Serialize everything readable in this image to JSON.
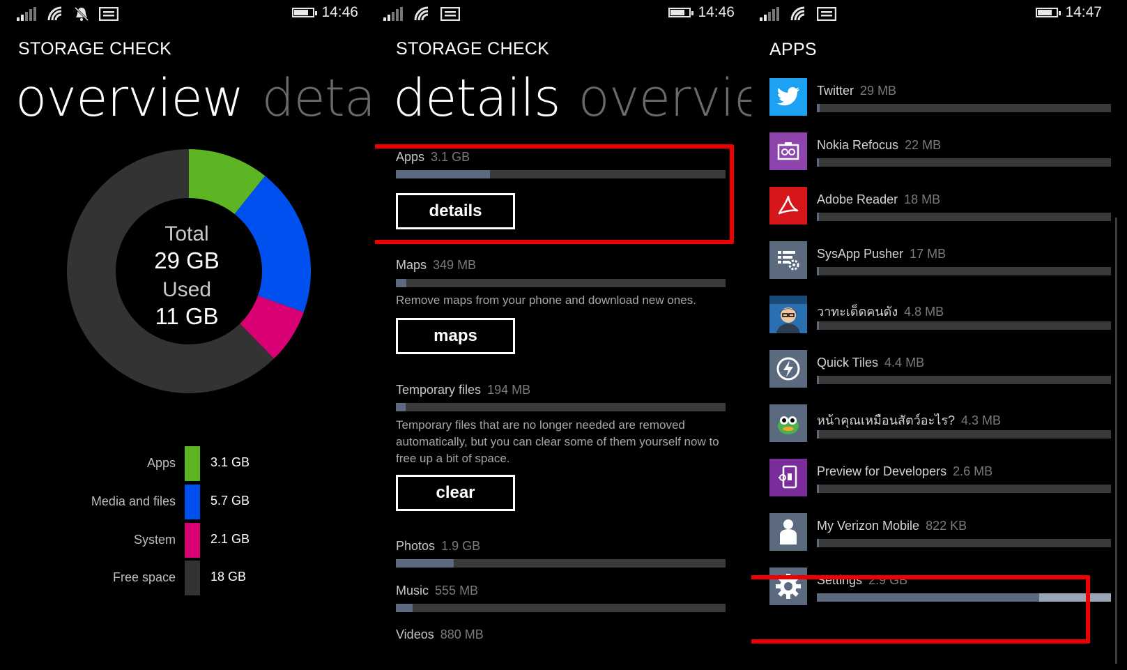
{
  "status": [
    {
      "time": "14:46"
    },
    {
      "time": "14:46"
    },
    {
      "time": "14:47"
    }
  ],
  "overview": {
    "app_title": "STORAGE CHECK",
    "pivot_active": "overview",
    "pivot_next": "detail",
    "center": {
      "total_label": "Total",
      "total_value": "29 GB",
      "used_label": "Used",
      "used_value": "11 GB"
    },
    "legend": [
      {
        "label": "Apps",
        "value": "3.1 GB",
        "color": "#5eb524"
      },
      {
        "label": "Media and files",
        "value": "5.7 GB",
        "color": "#0050ef"
      },
      {
        "label": "System",
        "value": "2.1 GB",
        "color": "#d80073"
      },
      {
        "label": "Free space",
        "value": "18 GB",
        "color": "#333333"
      }
    ],
    "chart_data": {
      "type": "pie",
      "categories": [
        "Apps",
        "Media and files",
        "System",
        "Free space"
      ],
      "values": [
        3.1,
        5.7,
        2.1,
        18
      ],
      "colors": [
        "#5eb524",
        "#0050ef",
        "#d80073",
        "#333333"
      ]
    }
  },
  "details": {
    "app_title": "STORAGE CHECK",
    "pivot_active": "details",
    "pivot_next": "overview",
    "categories": [
      {
        "name": "Apps",
        "size": "3.1 GB",
        "fraction": 0.285,
        "button": "details"
      },
      {
        "name": "Maps",
        "size": "349 MB",
        "fraction": 0.032,
        "desc": "Remove maps from your phone and download new ones.",
        "button": "maps"
      },
      {
        "name": "Temporary files",
        "size": "194 MB",
        "fraction": 0.018,
        "desc": "Temporary files that are no longer needed are removed automatically, but you can clear some of them yourself now to free up a bit of space.",
        "button": "clear"
      },
      {
        "name": "Photos",
        "size": "1.9 GB",
        "fraction": 0.175
      },
      {
        "name": "Music",
        "size": "555 MB",
        "fraction": 0.05
      },
      {
        "name": "Videos",
        "size": "880 MB"
      }
    ]
  },
  "apps": {
    "app_title": "APPS",
    "list": [
      {
        "name": "Twitter",
        "size": "29 MB",
        "icon": "twitter-icon",
        "color": "#1da1f2",
        "fraction": 0.01
      },
      {
        "name": "Nokia Refocus",
        "size": "22 MB",
        "icon": "refocus-icon",
        "color": "#8e44ad",
        "fraction": 0.008
      },
      {
        "name": "Adobe Reader",
        "size": "18 MB",
        "icon": "adobe-reader-icon",
        "color": "#d5161a",
        "fraction": 0.006
      },
      {
        "name": "SysApp Pusher",
        "size": "17 MB",
        "icon": "sysapp-pusher-icon",
        "color": "#5b6a7f",
        "fraction": 0.006
      },
      {
        "name": "วาทะเด็ดคนดัง",
        "size": "4.8 MB",
        "icon": "quote-avatar-icon",
        "color": "#2a6fb0",
        "fraction": 0.004
      },
      {
        "name": "Quick Tiles",
        "size": "4.4 MB",
        "icon": "quick-tiles-icon",
        "color": "#5b6a7f",
        "fraction": 0.004
      },
      {
        "name": "หน้าคุณเหมือนสัตว์อะไร?",
        "size": "4.3 MB",
        "icon": "animal-face-icon",
        "color": "#5b6a7f",
        "fraction": 0.004
      },
      {
        "name": "Preview for Developers",
        "size": "2.6 MB",
        "icon": "preview-dev-icon",
        "color": "#7b2d9c",
        "fraction": 0.003
      },
      {
        "name": "My Verizon Mobile",
        "size": "822 KB",
        "icon": "verizon-person-icon",
        "color": "#5b6a7f",
        "fraction": 0.002
      },
      {
        "name": "Settings",
        "size": "2.9 GB",
        "icon": "gear-icon",
        "color": "#5b6a7f",
        "fraction": 0.755,
        "fraction_light": 1.0
      }
    ]
  }
}
